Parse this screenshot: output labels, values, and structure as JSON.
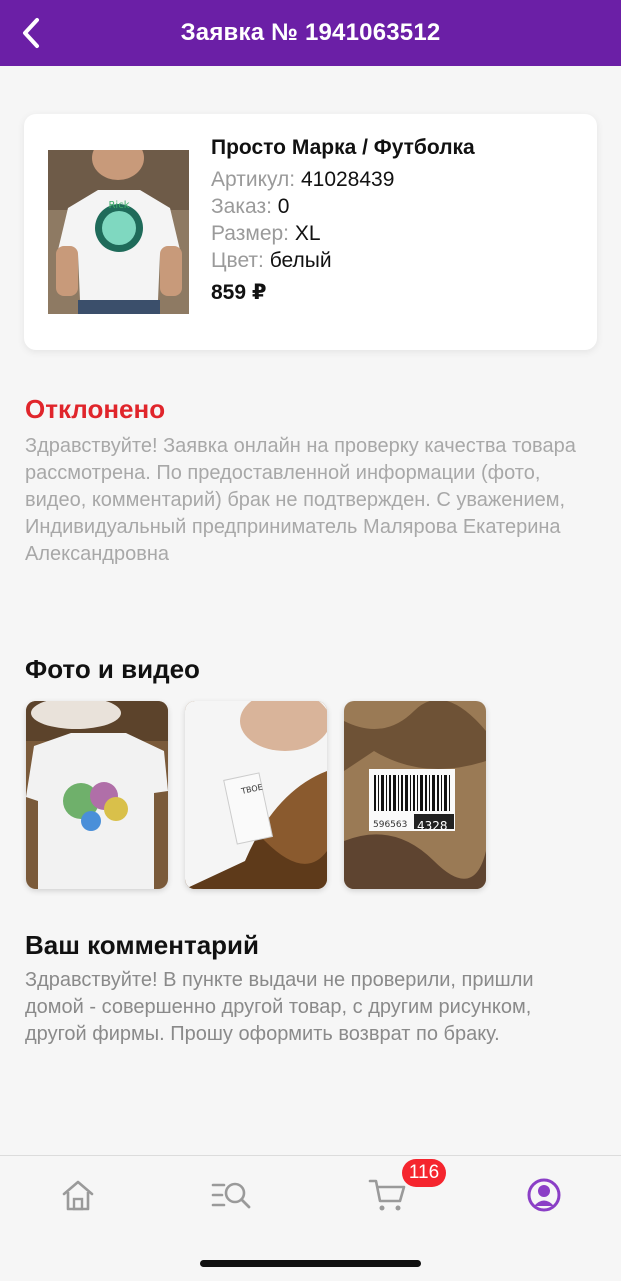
{
  "header": {
    "title": "Заявка № 1941063512"
  },
  "product": {
    "name": "Просто Марка / Футболка",
    "article_label": "Артикул:",
    "article_value": "41028439",
    "order_label": "Заказ:",
    "order_value": "0",
    "size_label": "Размер:",
    "size_value": "XL",
    "color_label": "Цвет:",
    "color_value": "белый",
    "price": "859 ₽"
  },
  "status": {
    "title": "Отклонено",
    "color": "#e0252b",
    "message": "Здравствуйте! Заявка онлайн на проверку качества товара рассмотрена. По предоставленной информации (фото, видео, комментарий) брак не подтвержден. С уважением, Индивидуальный предприниматель Малярова Екатерина Александровна"
  },
  "media": {
    "title": "Фото и видео",
    "photos": [
      {
        "icon": "tshirt-print-photo"
      },
      {
        "icon": "care-label-photo"
      },
      {
        "icon": "barcode-photo",
        "barcode_left": "596563",
        "barcode_right": "4328"
      }
    ]
  },
  "comment": {
    "title": "Ваш комментарий",
    "text": "Здравствуйте! В пункте выдачи не проверили, пришли домой - совершенно другой товар, с другим рисунком, другой фирмы. Прошу оформить возврат по браку."
  },
  "tabbar": {
    "items": [
      {
        "icon": "home-icon"
      },
      {
        "icon": "catalog-search-icon"
      },
      {
        "icon": "cart-icon"
      },
      {
        "icon": "profile-icon"
      }
    ],
    "cart_badge": "116",
    "accent": "#8b3fc6"
  },
  "colors": {
    "brand": "#6b1fa6",
    "badge": "#f5252e"
  }
}
